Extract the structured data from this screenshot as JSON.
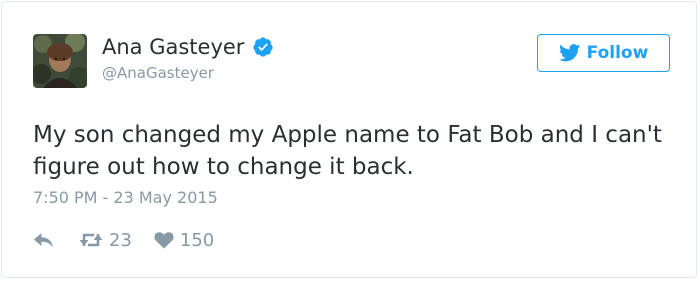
{
  "tweet": {
    "author": {
      "name": "Ana Gasteyer",
      "handle": "@AnaGasteyer",
      "verified": true
    },
    "follow_label": "Follow",
    "text": "My son changed my Apple name to Fat Bob and I can't figure out how to change it back.",
    "timestamp": "7:50 PM - 23 May 2015",
    "actions": {
      "reply_icon": "reply-icon",
      "retweet_icon": "retweet-icon",
      "like_icon": "heart-icon",
      "retweet_count": "23",
      "like_count": "150"
    }
  },
  "colors": {
    "accent": "#1da1f2",
    "text": "#292f33",
    "muted": "#8899a6",
    "border": "#e1e8ed"
  }
}
